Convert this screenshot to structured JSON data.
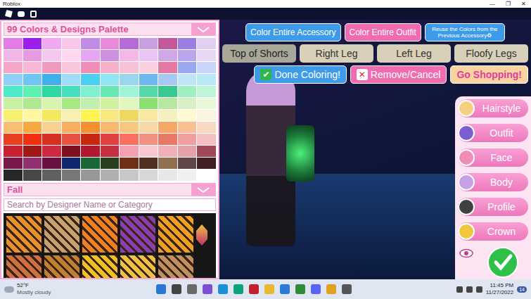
{
  "window": {
    "title": "Roblox",
    "controls": [
      "—",
      "❐",
      "✕"
    ]
  },
  "palette": {
    "title": "99 Colors & Designs Palette"
  },
  "swatch_rows": [
    [
      "#e27de6",
      "#9b1fe8",
      "#f0a8f0",
      "#f7c6ea",
      "#c18ce6",
      "#e68ad9",
      "#b46ad8",
      "#c8a0e0",
      "#c2589e",
      "#9b7fe0",
      "#e2d0f2"
    ],
    [
      "#f3b5e8",
      "#e69ae0",
      "#f5c8f0",
      "#ffd6f0",
      "#e7a6f2",
      "#cf8fe0",
      "#f4b8e6",
      "#e9c4f4",
      "#d0a8e8",
      "#b9a6ec",
      "#e8d8f4"
    ],
    [
      "#f5a6c8",
      "#f7b8d8",
      "#f09ac0",
      "#f9c6dc",
      "#ef8fb8",
      "#f4b0c8",
      "#f7c0d6",
      "#fad0e0",
      "#e27aa4",
      "#9aa8f0",
      "#c8d4f8"
    ],
    [
      "#8fd0f6",
      "#6fc6f2",
      "#3fb0ec",
      "#9edcf7",
      "#4bd0f0",
      "#8fe6f2",
      "#9ad6ef",
      "#6cb8ee",
      "#a8c8f4",
      "#c0e4f8",
      "#b8e8f4"
    ],
    [
      "#4fe8c8",
      "#5ef0b0",
      "#2ed8a0",
      "#46e0c0",
      "#80f0d0",
      "#6ae8b4",
      "#a0f4d8",
      "#58d8a8",
      "#38c890",
      "#9ef0c0",
      "#c0f4d8"
    ],
    [
      "#c8f0a0",
      "#b0e890",
      "#d8f4b0",
      "#a8e880",
      "#c0f0b0",
      "#d0f0a0",
      "#e0f8c0",
      "#8ce070",
      "#b8e8a0",
      "#d8f0c8",
      "#e8f8d8"
    ],
    [
      "#f8f070",
      "#fff8a0",
      "#f4e860",
      "#f8f0b0",
      "#fff450",
      "#f8e880",
      "#f0d860",
      "#f8e8a0",
      "#f4f0c0",
      "#fff8d0",
      "#f8f4e0"
    ],
    [
      "#f8c070",
      "#f8a840",
      "#f8d090",
      "#f8b060",
      "#f49030",
      "#f8b870",
      "#f8c880",
      "#f8d8a8",
      "#f4a868",
      "#f8c090",
      "#f8d8c0"
    ],
    [
      "#e84020",
      "#f03010",
      "#d83020",
      "#e85040",
      "#c82810",
      "#e04040",
      "#f87060",
      "#f09080",
      "#e87868",
      "#f0a0a0",
      "#f4c0c0"
    ],
    [
      "#c82030",
      "#a01818",
      "#d02840",
      "#801020",
      "#b01830",
      "#c83040",
      "#f4a0b0",
      "#f8c8d0",
      "#f0b0b8",
      "#e8a0a8",
      "#a04858"
    ],
    [
      "#781848",
      "#903070",
      "#681040",
      "#102870",
      "#1a6838",
      "#284020",
      "#703018",
      "#503020",
      "#907050",
      "#604848",
      "#402020"
    ],
    [
      "#282828",
      "#484848",
      "#606060",
      "#787878",
      "#989898",
      "#b0b0b0",
      "#c8c8c8",
      "#d8d8d8",
      "#e8e8e8",
      "#f0f0f0",
      "#ffffff"
    ]
  ],
  "design_category": {
    "label": "Fall"
  },
  "search": {
    "placeholder": "Search by Designer Name or Category"
  },
  "design_tiles": [
    {
      "color": "#e8902a"
    },
    {
      "color": "#c8a070"
    },
    {
      "color": "#f08020"
    },
    {
      "color": "#8a3fb0"
    },
    {
      "color": "#f0a020"
    },
    {
      "color": "#d07040"
    },
    {
      "color": "#c08030"
    },
    {
      "color": "#f0c020"
    },
    {
      "color": "#f0c040"
    },
    {
      "color": "#c09060"
    }
  ],
  "scope_buttons": [
    {
      "label": "Color Entire Accessory",
      "color": "#3d9be9"
    },
    {
      "label": "Color Entire Outfit",
      "color": "#f06bb0"
    },
    {
      "label": "Reuse the Colors from the Previous Accessory♻",
      "color": "#3d9be9"
    }
  ],
  "part_tabs": [
    {
      "label": "Top of Shorts",
      "selected": true
    },
    {
      "label": "Right Leg",
      "selected": false
    },
    {
      "label": "Left Leg",
      "selected": false
    },
    {
      "label": "Floofy Legs",
      "selected": false
    }
  ],
  "action_buttons": [
    {
      "icon": "✔",
      "label": "Done Coloring!",
      "color": "#3d9be9"
    },
    {
      "icon": "✕",
      "label": "Remove/Cancel",
      "color": "#f06bb0"
    },
    {
      "icon": "",
      "label": "Go Shopping!",
      "color": "#fbd3a0"
    }
  ],
  "menu": [
    {
      "label": "Hairstyle"
    },
    {
      "label": "Outfit"
    },
    {
      "label": "Face"
    },
    {
      "label": "Body"
    },
    {
      "label": "Profile"
    },
    {
      "label": "Crown"
    }
  ],
  "taskbar": {
    "temp": "52°F",
    "condition": "Mostly cloudy",
    "time": "11:45 PM",
    "date": "11/27/2022",
    "badge": "14"
  }
}
